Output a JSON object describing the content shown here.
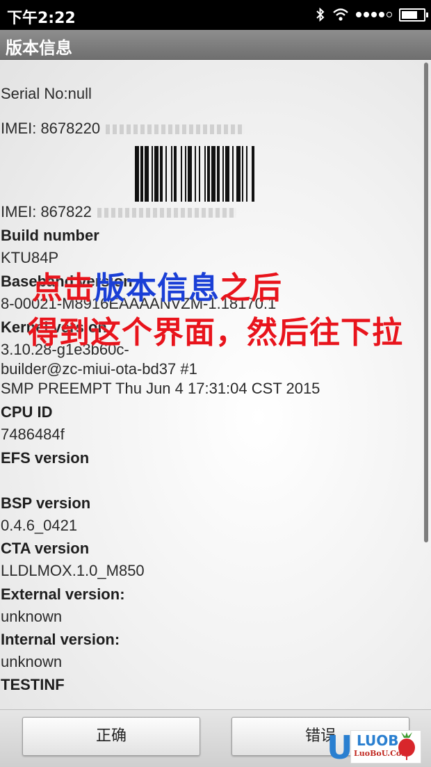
{
  "status_bar": {
    "time": "下午2:22",
    "icons": [
      "bluetooth-icon",
      "wifi-icon",
      "signal-icon",
      "battery-icon"
    ]
  },
  "title_bar": {
    "title": "版本信息"
  },
  "content": {
    "lines": [
      {
        "text": "Serial No:null",
        "bold": false
      },
      {
        "text": "IMEI: 8678220",
        "bold": false
      },
      {
        "text": "IMEI: 867822",
        "bold": false
      },
      {
        "text": "Build number",
        "bold": true
      },
      {
        "text": "KTU84P",
        "bold": false
      },
      {
        "text": "Baseband version",
        "bold": true
      },
      {
        "text": "8-00021-M8916EAAAANVZM-1.18170.1",
        "bold": false
      },
      {
        "text": "Kernel version",
        "bold": true
      },
      {
        "text": "3.10.28-g1e3b60c-",
        "bold": false
      },
      {
        "text": "builder@zc-miui-ota-bd37 #1",
        "bold": false
      },
      {
        "text": "SMP PREEMPT Thu Jun 4 17:31:04 CST 2015",
        "bold": false
      },
      {
        "text": "CPU ID",
        "bold": true
      },
      {
        "text": "7486484f",
        "bold": false
      },
      {
        "text": "EFS version",
        "bold": true
      },
      {
        "text": "BSP version",
        "bold": true
      },
      {
        "text": "0.4.6_0421",
        "bold": false
      },
      {
        "text": "CTA version",
        "bold": true
      },
      {
        "text": "LLDLMOX.1.0_M850",
        "bold": false
      },
      {
        "text": "External version:",
        "bold": true
      },
      {
        "text": "unknown",
        "bold": false
      },
      {
        "text": "Internal version:",
        "bold": true
      },
      {
        "text": "unknown",
        "bold": false
      },
      {
        "text": "TESTINF",
        "bold": true
      }
    ]
  },
  "annotation": {
    "line1_a": "点击",
    "line1_b": "版本信息",
    "line1_c": "之后",
    "line2": "得到这个界面，然后往下拉",
    "colors": {
      "red": "#e8141c",
      "blue": "#1a3fd6"
    }
  },
  "buttons": {
    "ok_label": "正确",
    "error_label": "错误"
  },
  "watermark": {
    "brand": "LUOB",
    "domain": "LuoBoU.CoM"
  }
}
